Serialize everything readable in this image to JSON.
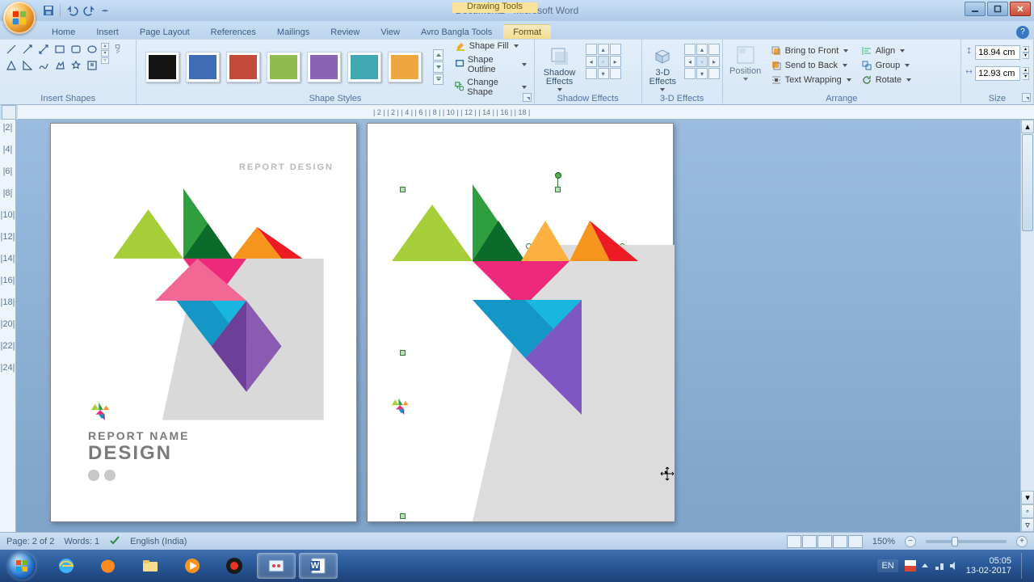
{
  "window": {
    "title": "Document2 - Microsoft Word",
    "context": "Drawing Tools"
  },
  "tabs": {
    "items": [
      "Home",
      "Insert",
      "Page Layout",
      "References",
      "Mailings",
      "Review",
      "View",
      "Avro Bangla Tools",
      "Format"
    ],
    "active": "Format"
  },
  "ribbon": {
    "insert_shapes": {
      "label": "Insert Shapes"
    },
    "shape_styles": {
      "label": "Shape Styles",
      "swatches": [
        "#141414",
        "#3e6db5",
        "#c14a3a",
        "#8fbb4f",
        "#8b63b5",
        "#3fa8b0",
        "#f0a63e"
      ],
      "fill": "Shape Fill",
      "outline": "Shape Outline",
      "change": "Change Shape"
    },
    "shadow": {
      "label": "Shadow Effects",
      "btn": "Shadow Effects"
    },
    "three_d": {
      "label": "3-D Effects",
      "btn": "3-D Effects"
    },
    "arrange": {
      "label": "Arrange",
      "position": "Position",
      "front": "Bring to Front",
      "back": "Send to Back",
      "wrap": "Text Wrapping",
      "align": "Align",
      "group": "Group",
      "rotate": "Rotate"
    },
    "size": {
      "label": "Size",
      "h": "18.94 cm",
      "w": "12.93 cm"
    }
  },
  "ruler": {
    "h_ticks": "| 2 |    | 2 |    | 4 |    | 6 |    | 8 |    | 10 |    | 12 |    | 14 |    | 16 |    | 18 |",
    "v_ticks": [
      "",
      "|2|",
      "",
      "|4|",
      "",
      "|6|",
      "",
      "|8|",
      "",
      "|10|",
      "",
      "|12|",
      "",
      "|14|",
      "",
      "|16|",
      "",
      "|18|",
      "",
      "|20|",
      "",
      "|22|",
      "",
      "|24|"
    ]
  },
  "page1": {
    "heading": "REPORT DESIGN",
    "footer_l1": "REPORT NAME",
    "footer_l2": "DESIGN"
  },
  "status": {
    "page": "Page: 2 of 2",
    "words": "Words: 1",
    "lang": "English (India)",
    "zoom": "150%"
  },
  "taskbar": {
    "lang": "EN",
    "time": "05:05",
    "date": "13-02-2017"
  }
}
